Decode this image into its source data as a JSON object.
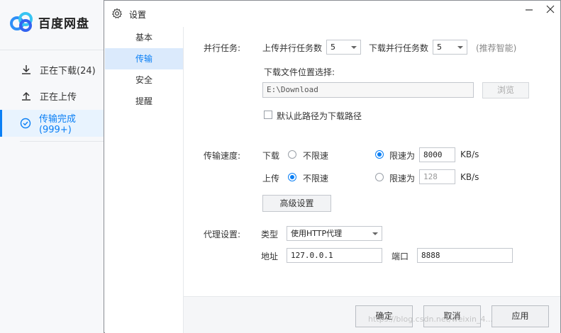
{
  "app": {
    "brand": "百度网盘",
    "nav": [
      {
        "label": "正在下载(24)",
        "icon": "download-icon"
      },
      {
        "label": "正在上传",
        "icon": "upload-icon"
      },
      {
        "label": "传输完成(999+)",
        "icon": "check-circle-icon"
      }
    ],
    "active_nav": 2
  },
  "dialog": {
    "title": "设置",
    "categories": [
      "基本",
      "传输",
      "安全",
      "提醒"
    ],
    "active_category": 1,
    "parallel": {
      "section_label": "并行任务:",
      "upload_label": "上传并行任务数",
      "upload_value": "5",
      "download_label": "下载并行任务数",
      "download_value": "5",
      "hint": "(推荐智能)"
    },
    "location": {
      "label": "下载文件位置选择:",
      "path": "E:\\Download",
      "browse": "浏览",
      "default_checkbox": "默认此路径为下载路径",
      "default_checked": false
    },
    "speed": {
      "section_label": "传输速度:",
      "download_label": "下载",
      "upload_label": "上传",
      "unlimited": "不限速",
      "limit_to": "限速为",
      "download_mode": "limit",
      "download_limit": "8000",
      "upload_mode": "unlimited",
      "upload_limit": "128",
      "unit": "KB/s",
      "advanced": "高级设置"
    },
    "proxy": {
      "section_label": "代理设置:",
      "type_label": "类型",
      "type_value": "使用HTTP代理",
      "address_label": "地址",
      "address_value": "127.0.0.1",
      "port_label": "端口",
      "port_value": "8888"
    },
    "footer": {
      "ok": "确定",
      "cancel": "取消",
      "apply": "应用"
    }
  },
  "watermark": "https://blog.csdn.net/weixin_4..."
}
